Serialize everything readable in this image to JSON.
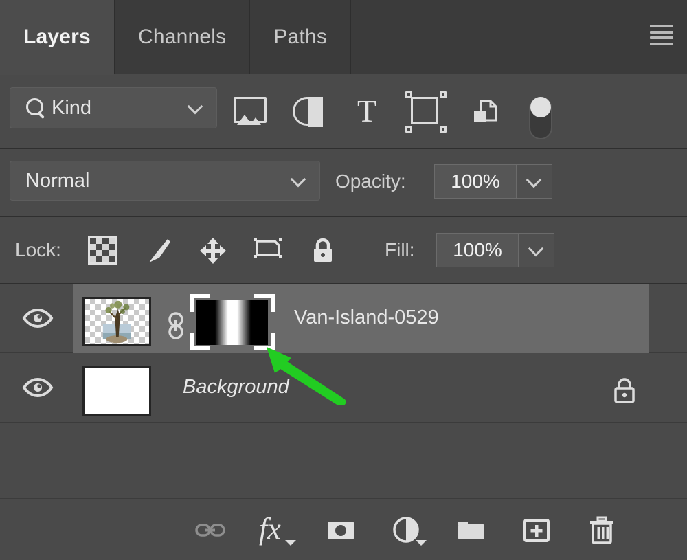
{
  "panel": {
    "title": "Layers",
    "background_color": "#4a4a4a",
    "accent_color": "#6a6a6a",
    "annotation_color": "#22cc22"
  },
  "tabs": [
    {
      "label": "Layers",
      "active": true,
      "name": "tab-layers"
    },
    {
      "label": "Channels",
      "active": false,
      "name": "tab-channels"
    },
    {
      "label": "Paths",
      "active": false,
      "name": "tab-paths"
    }
  ],
  "menu": {
    "icon": "hamburger-menu-icon"
  },
  "filter_row": {
    "kind_label": "Kind",
    "search_icon": "search-icon",
    "dropdown_icon": "chevron-down-icon",
    "filter_icons": [
      {
        "name": "filter-pixel-layers-icon",
        "icon": "image-icon"
      },
      {
        "name": "filter-adjustment-icon",
        "icon": "half-circle-icon"
      },
      {
        "name": "filter-type-layers-icon",
        "icon": "type-t-icon",
        "glyph": "T"
      },
      {
        "name": "filter-shape-layers-icon",
        "icon": "shape-nodes-icon"
      },
      {
        "name": "filter-smart-objects-icon",
        "icon": "smart-object-icon"
      },
      {
        "name": "filter-toggle-switch",
        "icon": "toggle-switch-icon"
      }
    ]
  },
  "blend_row": {
    "blend_mode": "Normal",
    "opacity_label": "Opacity:",
    "opacity_value": "100%"
  },
  "lock_row": {
    "lock_label": "Lock:",
    "lock_icons": [
      {
        "name": "lock-transparent-pixels-icon",
        "icon": "checkerboard-icon"
      },
      {
        "name": "lock-image-pixels-icon",
        "icon": "brush-icon"
      },
      {
        "name": "lock-position-icon",
        "icon": "move-arrows-icon"
      },
      {
        "name": "lock-artboard-nesting-icon",
        "icon": "artboard-icon"
      },
      {
        "name": "lock-all-icon",
        "icon": "padlock-icon"
      }
    ],
    "fill_label": "Fill:",
    "fill_value": "100%"
  },
  "layers": [
    {
      "name": "Van-Island-0529",
      "visible": true,
      "selected": true,
      "italic": false,
      "locked": false,
      "has_mask": true,
      "mask_selected": true,
      "mask_linked": true,
      "thumbnail": "transparent-checkerboard-with-tree-image"
    },
    {
      "name": "Background",
      "visible": true,
      "selected": false,
      "italic": true,
      "locked": true,
      "has_mask": false,
      "mask_selected": false,
      "mask_linked": false,
      "thumbnail": "white-solid"
    }
  ],
  "bottom_toolbar": [
    {
      "name": "link-layers-button",
      "icon": "chain-link-icon",
      "disabled": true,
      "has_caret": false
    },
    {
      "name": "layer-style-button",
      "icon": "fx-icon",
      "glyph": "fx",
      "disabled": false,
      "has_caret": true
    },
    {
      "name": "add-layer-mask-button",
      "icon": "mask-icon",
      "disabled": false,
      "has_caret": false
    },
    {
      "name": "new-adjustment-layer-button",
      "icon": "half-circle-icon",
      "disabled": false,
      "has_caret": true
    },
    {
      "name": "new-group-button",
      "icon": "folder-icon",
      "disabled": false,
      "has_caret": false
    },
    {
      "name": "new-layer-button",
      "icon": "plus-square-icon",
      "disabled": false,
      "has_caret": false
    },
    {
      "name": "delete-layer-button",
      "icon": "trash-icon",
      "disabled": false,
      "has_caret": false
    }
  ],
  "annotation": {
    "type": "arrow",
    "points_at": "layer-mask-thumbnail",
    "color": "#22cc22"
  }
}
